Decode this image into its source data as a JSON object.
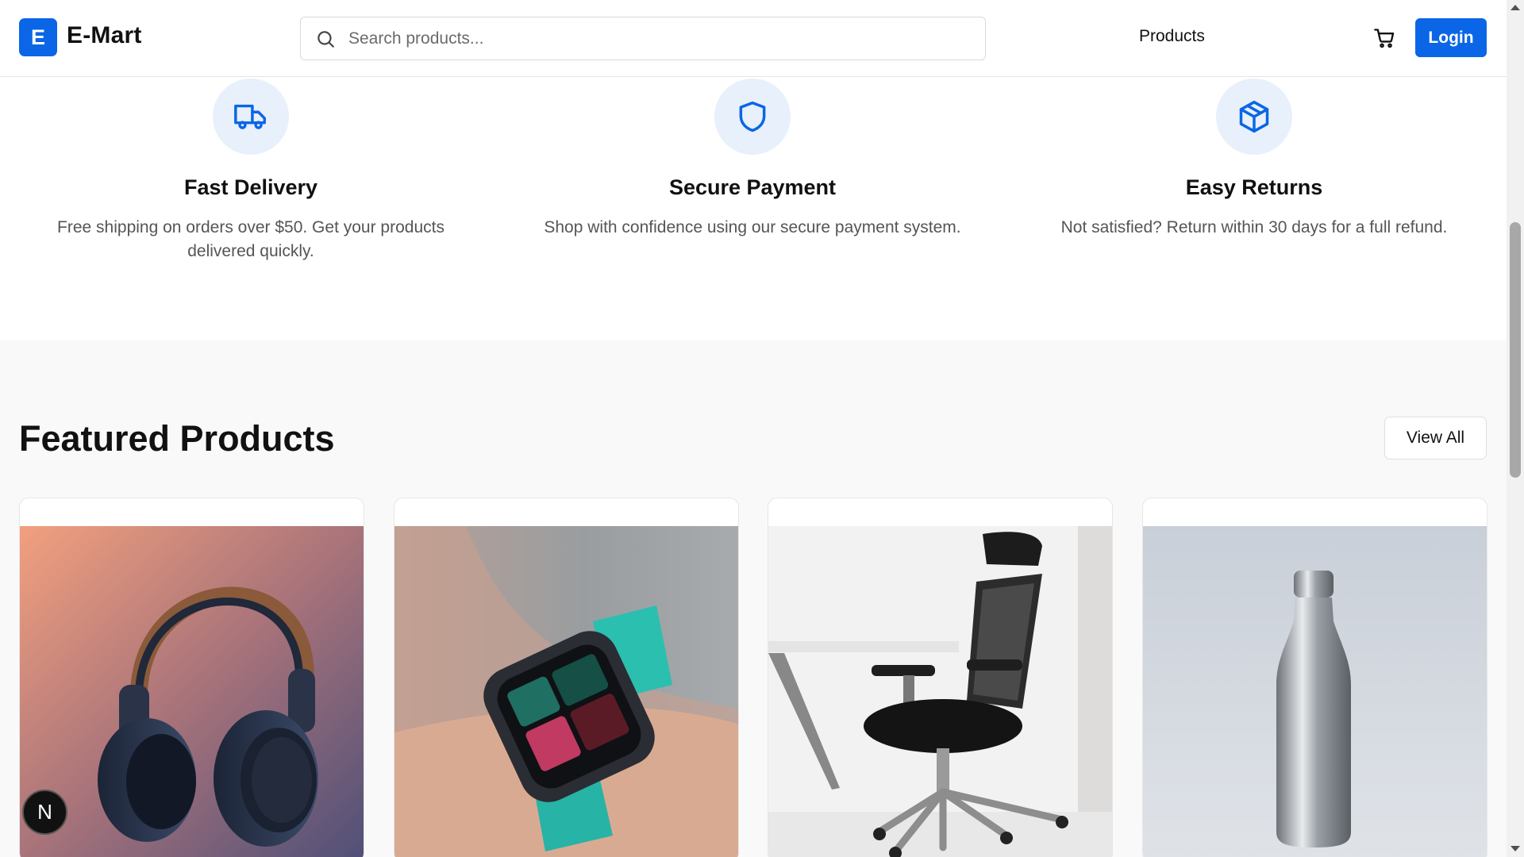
{
  "header": {
    "logo_letter": "E",
    "brand": "E-Mart",
    "search_placeholder": "Search products...",
    "nav_products": "Products",
    "login_label": "Login",
    "accent_color": "#0a66e6"
  },
  "features": [
    {
      "icon": "truck-icon",
      "title": "Fast Delivery",
      "description": "Free shipping on orders over $50. Get your products delivered quickly."
    },
    {
      "icon": "shield-icon",
      "title": "Secure Payment",
      "description": "Shop with confidence using our secure payment system."
    },
    {
      "icon": "box-icon",
      "title": "Easy Returns",
      "description": "Not satisfied? Return within 30 days for a full refund."
    }
  ],
  "featured": {
    "title": "Featured Products",
    "view_all_label": "View All",
    "products": [
      {
        "image": "headphones-image"
      },
      {
        "image": "smartwatch-image"
      },
      {
        "image": "office-chair-image"
      },
      {
        "image": "water-bottle-image"
      }
    ]
  },
  "badge": {
    "letter": "N"
  }
}
